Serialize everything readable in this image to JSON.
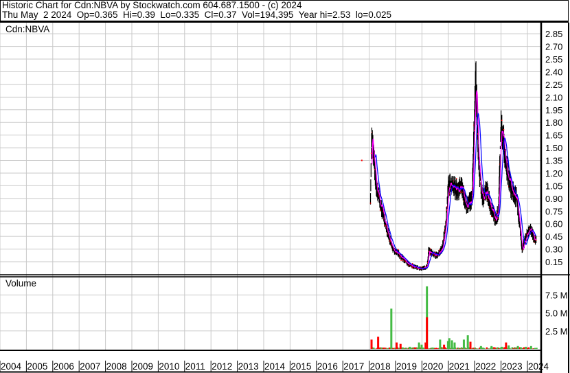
{
  "header": {
    "line1": "Historic Chart for Cdn:NBVA by Stockwatch.com 604.687.1500 - (c) 2024",
    "line2": "Thu May  2 2024  Op=0.365  Hi=0.39  Lo=0.335  Cl=0.37  Vol=194,395  Year hi=2.53  lo=0.025"
  },
  "colors": {
    "price": "#000000",
    "ma_short": "#ff00ff",
    "ma_long": "#0000ff",
    "close_dot": "#ff0000",
    "vol_up": "#44bb44",
    "vol_down": "#ff0000",
    "grid": "#c8c8c8"
  },
  "chart_data": [
    {
      "type": "line",
      "title": "Cdn:NBVA",
      "xlim": [
        2004,
        2024.35
      ],
      "ylim": [
        0,
        2.95
      ],
      "y_ticks": [
        "2.85",
        "2.70",
        "2.55",
        "2.40",
        "2.25",
        "2.10",
        "1.95",
        "1.80",
        "1.65",
        "1.50",
        "1.35",
        "1.20",
        "1.05",
        "0.90",
        "0.75",
        "0.60",
        "0.45",
        "0.30",
        "0.15"
      ],
      "x_ticks": [
        "2004",
        "2005",
        "2006",
        "2007",
        "2008",
        "2009",
        "2010",
        "2011",
        "2012",
        "2013",
        "2014",
        "2015",
        "2016",
        "2017",
        "2018",
        "2019",
        "2020",
        "2021",
        "2022",
        "2023",
        "2024"
      ],
      "grid": true,
      "series": [
        {
          "name": "price",
          "x": [
            2017.72,
            2018.05,
            2018.1,
            2018.15,
            2018.25,
            2018.35,
            2018.5,
            2018.7,
            2018.9,
            2019.1,
            2019.3,
            2019.5,
            2019.8,
            2020.0,
            2020.2,
            2020.25,
            2020.4,
            2020.6,
            2020.75,
            2020.9,
            2021.0,
            2021.15,
            2021.3,
            2021.5,
            2021.7,
            2021.9,
            2022.0,
            2022.05,
            2022.15,
            2022.3,
            2022.45,
            2022.6,
            2022.8,
            2022.9,
            2023.0,
            2023.05,
            2023.2,
            2023.4,
            2023.6,
            2023.7,
            2023.8,
            2023.95,
            2024.1,
            2024.3
          ],
          "y": [
            1.35,
            0.9,
            1.7,
            1.5,
            1.1,
            0.95,
            0.75,
            0.5,
            0.3,
            0.25,
            0.18,
            0.12,
            0.08,
            0.07,
            0.09,
            0.28,
            0.24,
            0.22,
            0.3,
            0.55,
            1.05,
            1.05,
            1.0,
            1.02,
            0.8,
            0.9,
            2.0,
            2.3,
            1.3,
            0.9,
            1.0,
            0.8,
            0.65,
            0.75,
            1.8,
            1.7,
            1.3,
            1.0,
            0.9,
            0.6,
            0.3,
            0.45,
            0.55,
            0.4
          ]
        }
      ]
    },
    {
      "type": "bar",
      "title": "Volume",
      "ylim": [
        0,
        9.5
      ],
      "y_ticks": [
        "7.5 M",
        "5.0 M",
        "2.5 M"
      ],
      "bars": [
        [
          2018.05,
          1.3,
          "down"
        ],
        [
          2018.3,
          1.7,
          "down"
        ],
        [
          2018.8,
          5.6,
          "up"
        ],
        [
          2019.0,
          0.9,
          "down"
        ],
        [
          2019.15,
          0.7,
          "down"
        ],
        [
          2019.5,
          0.3,
          "up"
        ],
        [
          2019.85,
          0.9,
          "up"
        ],
        [
          2019.95,
          0.6,
          "up"
        ],
        [
          2020.1,
          0.9,
          "down"
        ],
        [
          2020.15,
          8.7,
          "up"
        ],
        [
          2020.15,
          4.4,
          "down"
        ],
        [
          2020.65,
          1.3,
          "up"
        ],
        [
          2020.8,
          0.6,
          "down"
        ],
        [
          2020.95,
          1.1,
          "up"
        ],
        [
          2021.0,
          1.5,
          "up"
        ],
        [
          2021.1,
          1.2,
          "up"
        ],
        [
          2021.2,
          0.9,
          "up"
        ],
        [
          2021.55,
          1.3,
          "up"
        ],
        [
          2021.7,
          1.9,
          "up"
        ],
        [
          2021.8,
          1.0,
          "down"
        ],
        [
          2022.2,
          0.4,
          "up"
        ],
        [
          2022.6,
          0.4,
          "up"
        ],
        [
          2023.0,
          0.3,
          "up"
        ],
        [
          2023.15,
          0.9,
          "down"
        ],
        [
          2023.25,
          0.5,
          "up"
        ],
        [
          2023.6,
          0.4,
          "up"
        ],
        [
          2023.9,
          0.3,
          "up"
        ],
        [
          2024.1,
          0.4,
          "up"
        ]
      ]
    }
  ]
}
